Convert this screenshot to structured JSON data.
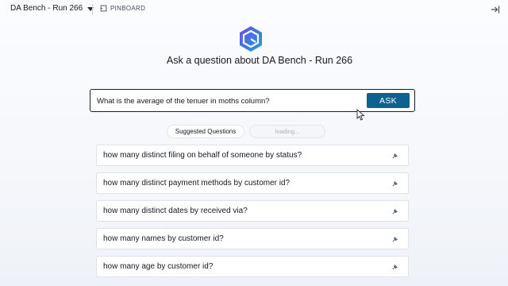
{
  "topbar": {
    "workspace_label": "DA Bench - Run 266",
    "pinboard_label": "PINBOARD"
  },
  "headline": "Ask a question about DA Bench - Run 266",
  "question": {
    "value": "What is the average of the tenuer in moths column?",
    "ask_label": "ASK"
  },
  "suggestions": {
    "header_label": "Suggested Questions",
    "loading_label": "loading...",
    "items": [
      "how many distinct filing on behalf of someone by status?",
      "how many distinct payment methods by customer id?",
      "how many distinct dates by received via?",
      "how many names by customer id?",
      "how many age by customer id?"
    ]
  },
  "colors": {
    "accent": "#0d6290",
    "logo_gradient": [
      "#5b5ce6",
      "#1a9fd9"
    ]
  },
  "icons": [
    "caret-down-icon",
    "pin-icon",
    "collapse-panel-icon",
    "app-logo-icon",
    "mouse-cursor-icon"
  ]
}
